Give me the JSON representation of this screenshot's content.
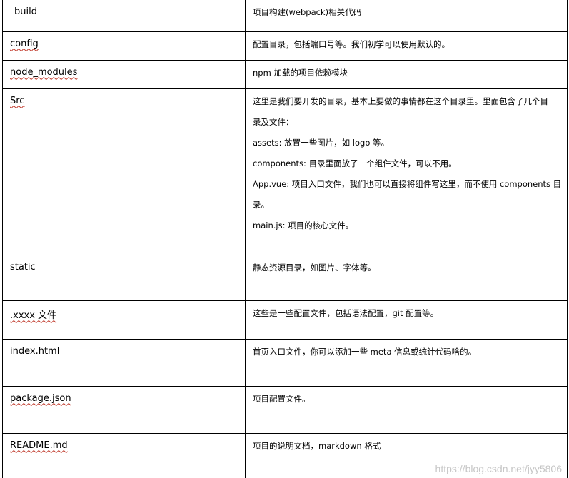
{
  "rows": [
    {
      "name": "build",
      "desc": [
        "项目构建(webpack)相关代码"
      ]
    },
    {
      "name": "config",
      "desc": [
        "配置目录，包括端口号等。我们初学可以使用默认的。"
      ]
    },
    {
      "name": "node_modules",
      "desc": [
        "npm 加载的项目依赖模块"
      ]
    },
    {
      "name": "Src",
      "desc": [
        "这里是我们要开发的目录，基本上要做的事情都在这个目录里。里面包含了几个目",
        "录及文件：",
        "assets: 放置一些图片，如 logo 等。",
        "components: 目录里面放了一个组件文件，可以不用。",
        "App.vue: 项目入口文件，我们也可以直接将组件写这里，而不使用 components 目",
        "录。",
        "main.js: 项目的核心文件。"
      ]
    },
    {
      "name": "static",
      "desc": [
        "静态资源目录，如图片、字体等。"
      ]
    },
    {
      "name": ".xxxx 文件",
      "desc": [
        "这些是一些配置文件，包括语法配置，git 配置等。"
      ]
    },
    {
      "name": "index.html",
      "desc": [
        "首页入口文件，你可以添加一些 meta 信息或统计代码啥的。"
      ]
    },
    {
      "name": "package.json",
      "desc": [
        "项目配置文件。"
      ]
    },
    {
      "name": "README.md",
      "desc": [
        "项目的说明文档，markdown 格式"
      ]
    }
  ],
  "watermark": "https://blog.csdn.net/jyy5806"
}
